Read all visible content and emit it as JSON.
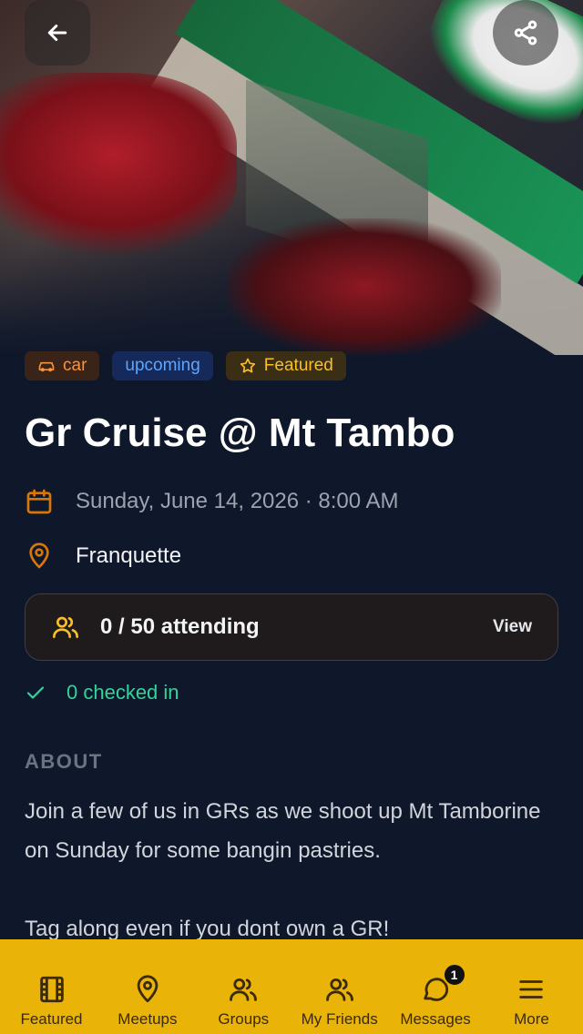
{
  "header": {
    "back_icon": "arrow-left-icon",
    "share_icon": "share-icon"
  },
  "tags": [
    {
      "label": "car",
      "icon": "car-icon",
      "color": "#fb923c"
    },
    {
      "label": "upcoming",
      "color": "#60a5fa"
    },
    {
      "label": "Featured",
      "icon": "star-icon",
      "color": "#fbbf24"
    }
  ],
  "event": {
    "title": "Gr Cruise @ Mt Tambo",
    "datetime": "Sunday, June 14, 2026 · 8:00 AM",
    "location": "Franquette"
  },
  "attendance": {
    "text": "0 / 50 attending",
    "view_label": "View",
    "checked_in": "0 checked in"
  },
  "about": {
    "label": "ABOUT",
    "paragraphs": [
      "Join a few of us in GRs as we shoot up Mt Tamborine on Sunday for some bangin pastries.",
      "Tag along even if you dont own a GR!"
    ]
  },
  "nav": {
    "items": [
      {
        "label": "Featured",
        "icon": "film-icon"
      },
      {
        "label": "Meetups",
        "icon": "map-pin-icon"
      },
      {
        "label": "Groups",
        "icon": "users-icon"
      },
      {
        "label": "My Friends",
        "icon": "users-icon"
      },
      {
        "label": "Messages",
        "icon": "message-icon",
        "badge": "1"
      },
      {
        "label": "More",
        "icon": "menu-icon"
      }
    ]
  },
  "colors": {
    "background": "#0f172a",
    "accent": "#eab308",
    "icon_accent": "#d97706"
  }
}
